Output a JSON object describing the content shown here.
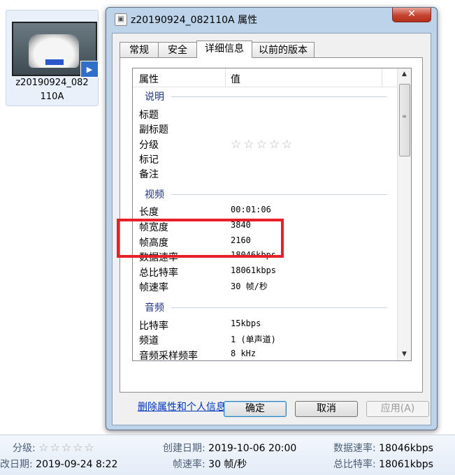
{
  "file": {
    "name_line1": "z20190924_082",
    "name_line2": "110A"
  },
  "dialog": {
    "title": "z20190924_082110A 属性",
    "close_label": "✕",
    "tabs": [
      "常规",
      "安全",
      "详细信息",
      "以前的版本"
    ],
    "columns": {
      "property": "属性",
      "value": "值"
    },
    "groups": {
      "description": "说明",
      "video": "视频",
      "audio": "音频"
    },
    "description_rows": [
      {
        "name": "标题",
        "value": ""
      },
      {
        "name": "副标题",
        "value": ""
      },
      {
        "name": "分级",
        "value": "☆☆☆☆☆"
      },
      {
        "name": "标记",
        "value": ""
      },
      {
        "name": "备注",
        "value": ""
      }
    ],
    "video_rows": [
      {
        "name": "长度",
        "value": "00:01:06"
      },
      {
        "name": "帧宽度",
        "value": "3840"
      },
      {
        "name": "帧高度",
        "value": "2160"
      },
      {
        "name": "数据速率",
        "value": "18046kbps"
      },
      {
        "name": "总比特率",
        "value": "18061kbps"
      },
      {
        "name": "帧速率",
        "value": "30 帧/秒"
      }
    ],
    "audio_rows": [
      {
        "name": "比特率",
        "value": "15kbps"
      },
      {
        "name": "频道",
        "value": "1 (单声道)"
      },
      {
        "name": "音频采样频率",
        "value": "8 kHz"
      }
    ],
    "remove_link": "删除属性和个人信息",
    "buttons": {
      "ok": "确定",
      "cancel": "取消",
      "apply": "应用(A)"
    }
  },
  "details_pane": {
    "rating_label": "分级:",
    "rating_stars": "☆☆☆☆☆",
    "modified_label": "修改日期:",
    "modified_value": "2019-09-24 8:22",
    "created_label": "创建日期:",
    "created_value": "2019-10-06 20:00",
    "framerate_label": "帧速率:",
    "framerate_value": "30 帧/秒",
    "datarate_label": "数据速率:",
    "datarate_value": "18046kbps",
    "bitrate_label": "总比特率:",
    "bitrate_value": "18061kbps"
  },
  "colors": {
    "highlight": "#e8202a",
    "group_text": "#1e3287",
    "link": "#0033bb"
  }
}
